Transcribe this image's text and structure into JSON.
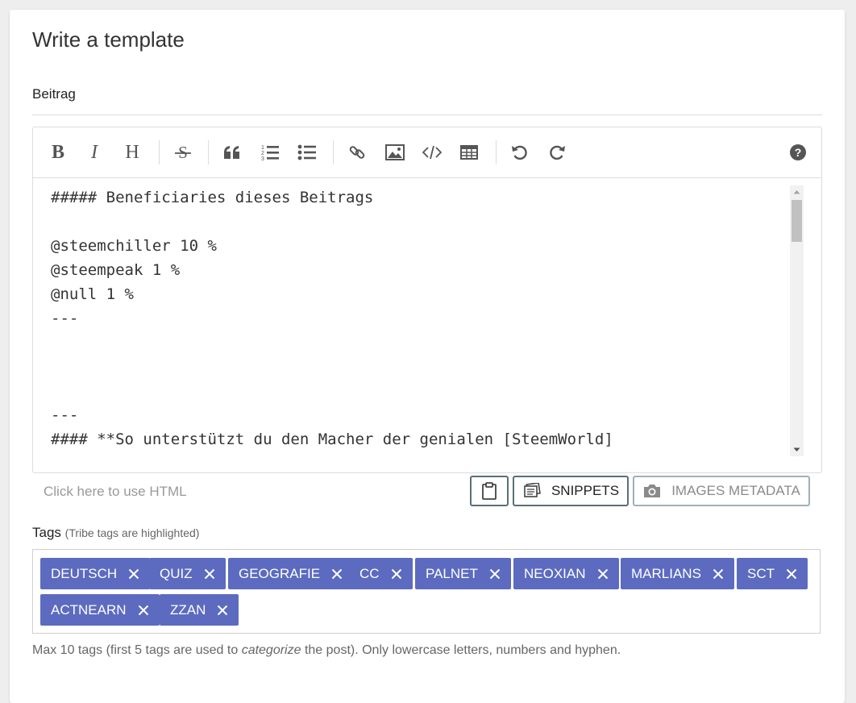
{
  "page": {
    "title": "Write a template",
    "section_label": "Beitrag"
  },
  "toolbar": {
    "bold": "B",
    "italic": "I",
    "heading": "H"
  },
  "editor": {
    "lines": [
      "##### Beneficiaries dieses Beitrags",
      "",
      "@steemchiller 10 %",
      "@steempeak 1 %",
      "@null 1 %",
      "---",
      "",
      "",
      "",
      "---",
      "#### **So unterstützt du den Macher der genialen [SteemWorld]"
    ]
  },
  "actions": {
    "html_link": "Click here to use HTML",
    "snippets_label": "SNIPPETS",
    "images_metadata_label": "IMAGES METADATA"
  },
  "tags": {
    "label": "Tags",
    "hint": "(Tribe tags are highlighted)",
    "items": [
      "DEUTSCH",
      "QUIZ",
      "GEOGRAFIE",
      "CC",
      "PALNET",
      "NEOXIAN",
      "MARLIANS",
      "SCT",
      "ACTNEARN",
      "ZZAN"
    ],
    "tag_color": "#5c6bc0"
  },
  "help": {
    "before": "Max 10 tags (first 5 tags are used to ",
    "emphasis": "categorize",
    "after": " the post). Only lowercase letters, numbers and hyphen."
  }
}
